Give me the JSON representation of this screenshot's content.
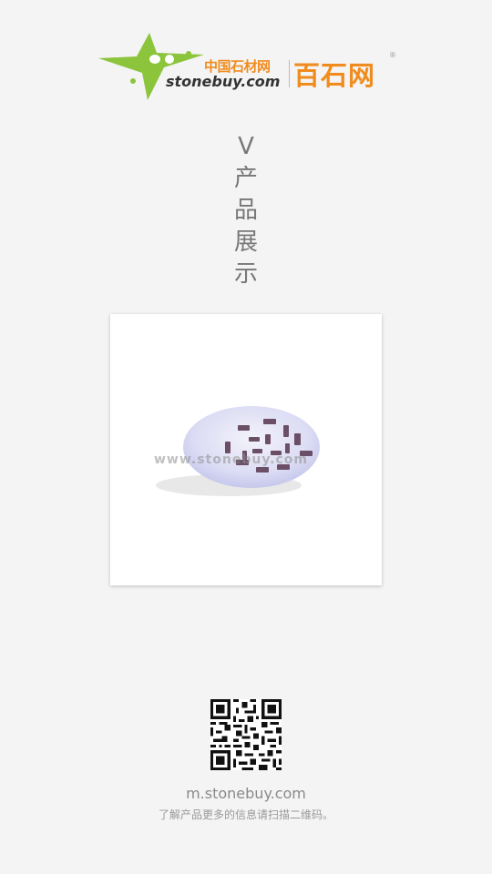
{
  "logo": {
    "cn_small": "中国石材网",
    "en": "stonebuy.com",
    "cn_big": "百石网",
    "reg_mark": "®",
    "green": "#8cc43c",
    "orange": "#f08c1e"
  },
  "section": {
    "chars": [
      "V",
      "产",
      "品",
      "展",
      "示"
    ]
  },
  "product": {
    "watermark": "www.stonebuy.com",
    "icon": "product-photo"
  },
  "footer": {
    "url": "m.stonebuy.com",
    "hint": "了解产品更多的信息请扫描二维码。",
    "qr_icon": "qr-code-icon"
  }
}
